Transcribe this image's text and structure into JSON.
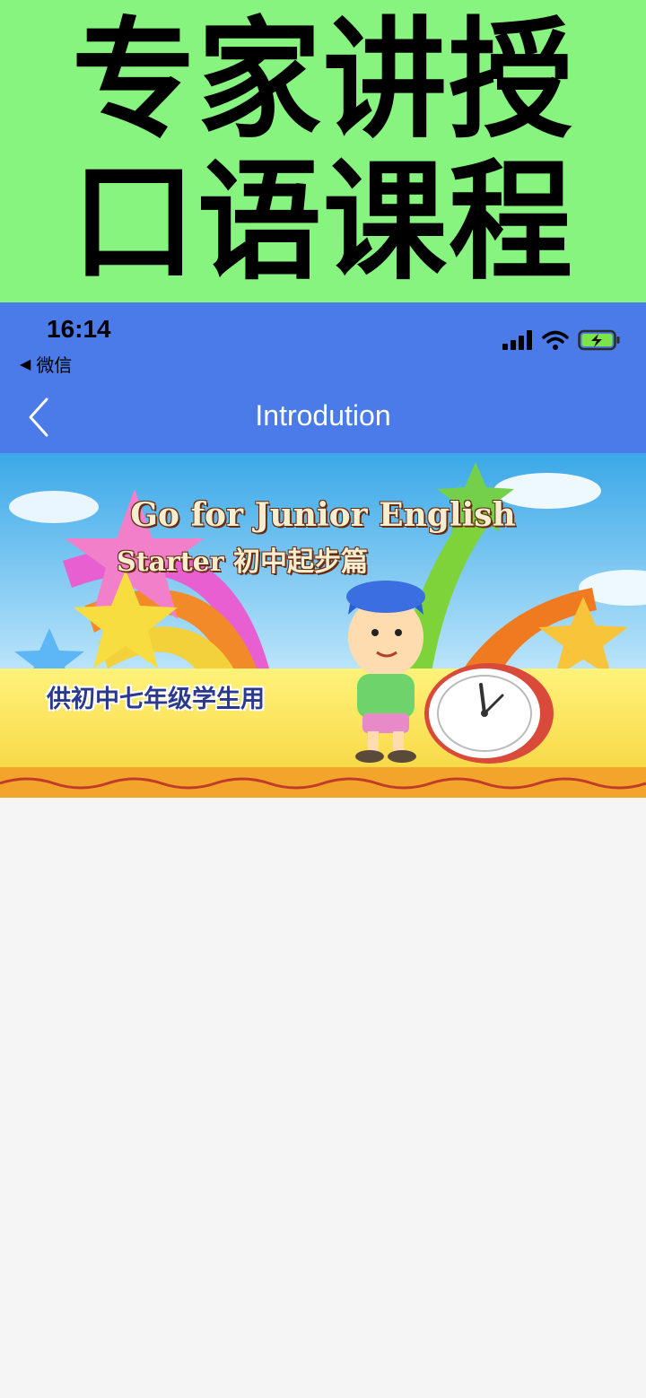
{
  "promo": {
    "line1": "专家讲授",
    "line2": "口语课程"
  },
  "status_bar": {
    "time": "16:14",
    "back_app_label": "微信",
    "icons": [
      "cellular-signal-icon",
      "wifi-icon",
      "battery-charging-icon"
    ]
  },
  "nav": {
    "title": "Introdution",
    "back_icon": "chevron-left-icon"
  },
  "hero": {
    "title_line1": "Go for Junior English",
    "title_line2": "Starter   初中起步篇",
    "subtitle": "供初中七年级学生用"
  },
  "colors": {
    "promo_bg": "#86f47e",
    "header_blue": "#4a7be8",
    "page_bg": "#f5f5f5"
  }
}
